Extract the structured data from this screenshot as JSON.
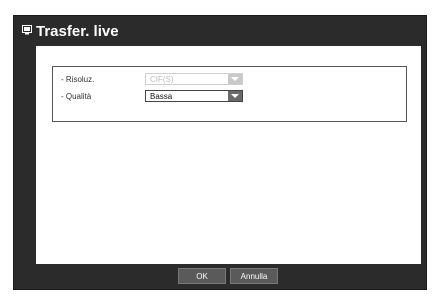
{
  "dialog": {
    "title": "Trasfer. live",
    "title_icon": "monitor-icon"
  },
  "settings": {
    "resolution": {
      "label": "- Risoluz.",
      "value": "CIF(S)",
      "enabled": false
    },
    "quality": {
      "label": "- Qualità",
      "value": "Bassa",
      "enabled": true
    }
  },
  "buttons": {
    "ok": "OK",
    "cancel": "Annulla"
  },
  "colors": {
    "frame": "#2b2b2b",
    "panel": "#ffffff",
    "button": "#5a5a5a"
  }
}
